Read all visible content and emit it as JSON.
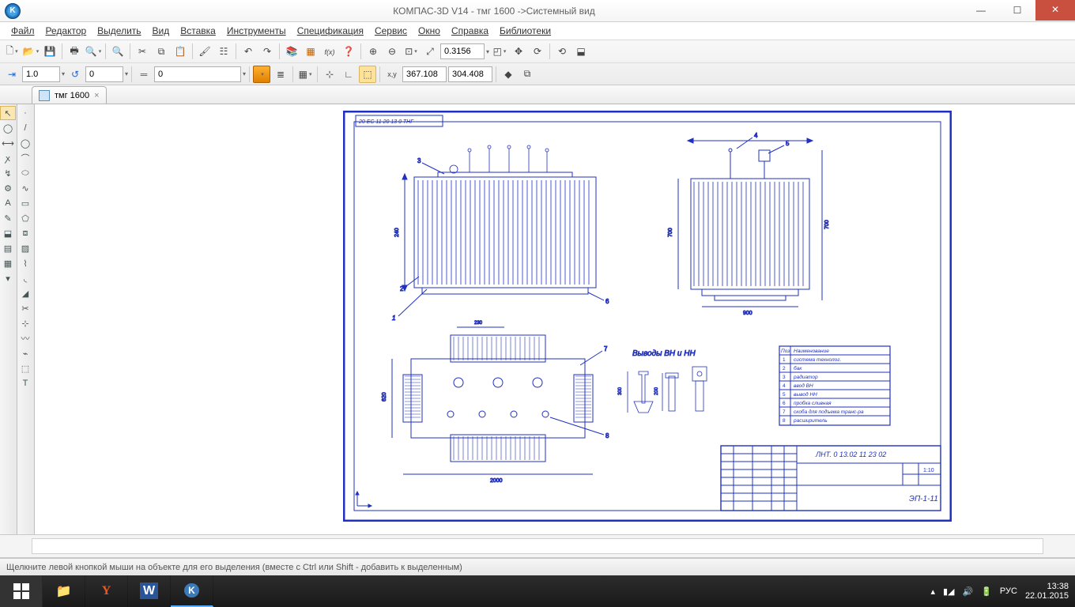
{
  "title": "КОМПАС-3D V14 - тмг 1600 ->Системный вид",
  "menu": [
    "Файл",
    "Редактор",
    "Выделить",
    "Вид",
    "Вставка",
    "Инструменты",
    "Спецификация",
    "Сервис",
    "Окно",
    "Справка",
    "Библиотеки"
  ],
  "toolbar1": {
    "zoom_pct": "0.3156"
  },
  "toolbar2": {
    "step1": "1.0",
    "step2": "0",
    "style": "0",
    "coord_x": "367.108",
    "coord_y": "304.408"
  },
  "doctab": {
    "name": "тмг 1600"
  },
  "status": "Щелкните левой кнопкой мыши на объекте для его выделения (вместе с Ctrl или Shift - добавить к выделенным)",
  "tray": {
    "lang": "РУС",
    "time": "13:38",
    "date": "22.01.2015"
  },
  "drawing": {
    "header_stamp": "20 ЕС 11 20 13 0 ТНГ",
    "label_vyvoda": "Выводы ВН и НН",
    "dims": {
      "left_h": "240",
      "top_w": "2000",
      "top_gap": "230",
      "right_h1": "300",
      "right_h2": "200",
      "side_h": "700",
      "side_w": "900",
      "plan_h": "620"
    },
    "callouts": [
      "1",
      "2",
      "3",
      "4",
      "5",
      "6",
      "7",
      "8"
    ],
    "table": {
      "header": [
        "Поз",
        "Наименование"
      ],
      "rows": [
        [
          "1",
          "система технолог."
        ],
        [
          "2",
          "бак"
        ],
        [
          "3",
          "радиатор"
        ],
        [
          "4",
          "ввод ВН"
        ],
        [
          "5",
          "вывод НН"
        ],
        [
          "6",
          "пробка сливная"
        ],
        [
          "7",
          "скоба для подъема транс-ра"
        ],
        [
          "8",
          "расширитель"
        ]
      ]
    },
    "titleblock": {
      "code": "ЛНТ. 0 13.02 11 23 02",
      "sheet": "1:10",
      "group": "ЭП-1-11"
    }
  }
}
